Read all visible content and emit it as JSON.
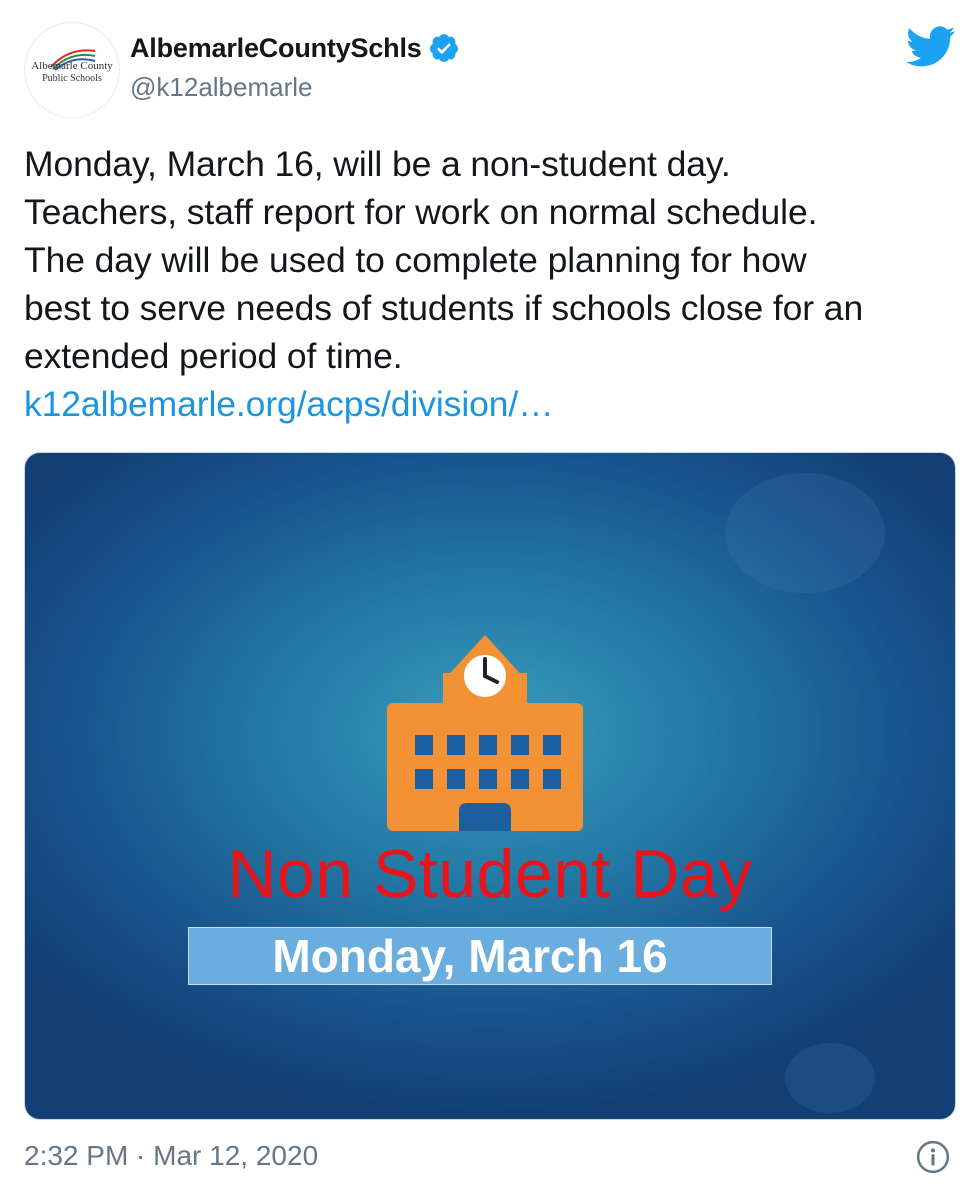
{
  "account": {
    "display_name": "AlbemarleCountySchls",
    "handle": "@k12albemarle",
    "verified": true,
    "avatar_text_line1": "Albemarle County",
    "avatar_text_line2": "Public Schools"
  },
  "tweet": {
    "text_lines": [
      "Monday, March 16, will be a non-student day.",
      "Teachers, staff report for work on normal schedule.",
      "The day will be used to complete planning for how",
      "best to serve needs of students if schools close for an",
      "extended period of time."
    ],
    "link_text": "k12albemarle.org/acps/division/…",
    "timestamp": "2:32 PM · Mar 12, 2020"
  },
  "media": {
    "headline": "Non Student Day",
    "date_banner": "Monday, March 16",
    "icon": "school-building-icon"
  },
  "icons": {
    "brand": "twitter-bird-icon",
    "verified": "verified-badge-icon",
    "info": "info-icon"
  },
  "colors": {
    "link": "#1b95e0",
    "verified": "#1da1f2",
    "twitter_brand": "#1da1f2",
    "muted_text": "#657786",
    "headline_red": "#e8141b",
    "banner_blue": "#6aaee0",
    "school_orange": "#f39235"
  }
}
